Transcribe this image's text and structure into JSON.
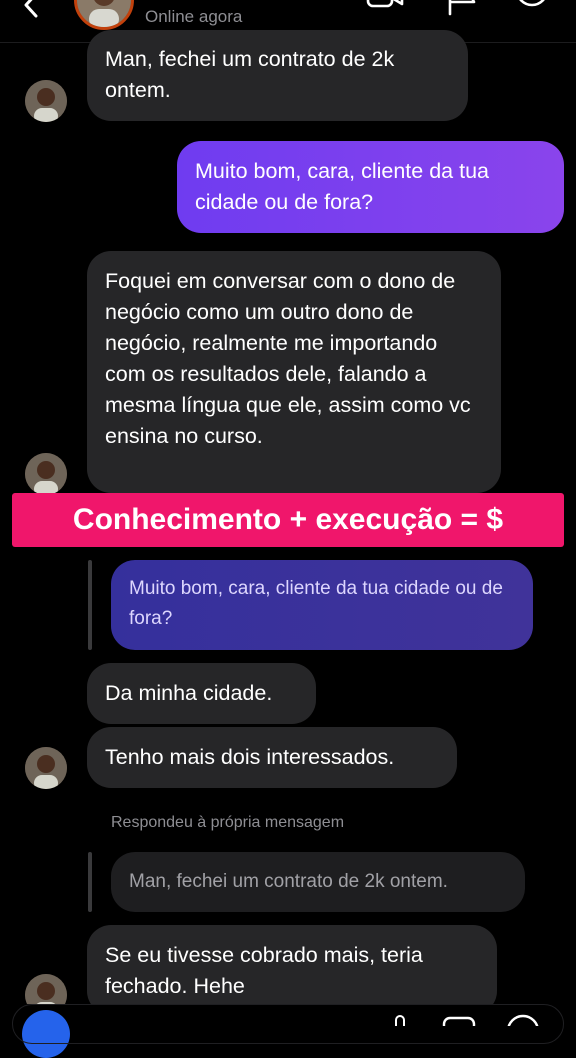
{
  "header": {
    "status": "Online agora",
    "icons": [
      "back-icon",
      "avatar",
      "video-call-icon",
      "flag-icon",
      "info-icon"
    ]
  },
  "messages": [
    {
      "side": "received",
      "text": "Man, fechei um contrato de 2k ontem."
    },
    {
      "side": "sent",
      "text": "Muito bom, cara, cliente da tua cidade ou de fora?"
    },
    {
      "side": "received",
      "text": "Foquei em conversar com o dono de negócio como um outro dono de negócio, realmente me importando com os resultados dele, falando a mesma língua que ele, assim como vc ensina no curso."
    },
    {
      "side": "received",
      "type": "reply-quote",
      "text": "Muito bom, cara, cliente da tua cidade ou de fora?"
    },
    {
      "side": "received",
      "text": "Da minha cidade."
    },
    {
      "side": "received",
      "text": "Tenho mais dois interessados."
    },
    {
      "side": "received",
      "type": "reply-quote",
      "text": "Man, fechei um contrato de 2k ontem."
    },
    {
      "side": "received",
      "text": "Se eu tivesse cobrado mais, teria fechado. Hehe"
    }
  ],
  "banner": "Conhecimento + execução = $",
  "reply_label": "Respondeu à própria mensagem",
  "colors": {
    "background": "#000000",
    "received_bubble": "#262628",
    "sent_bubble": "#7c3aed",
    "quoted_sent_bubble": "#3a2f9a",
    "banner": "#f0166b",
    "muted_text": "#8e8e93"
  }
}
